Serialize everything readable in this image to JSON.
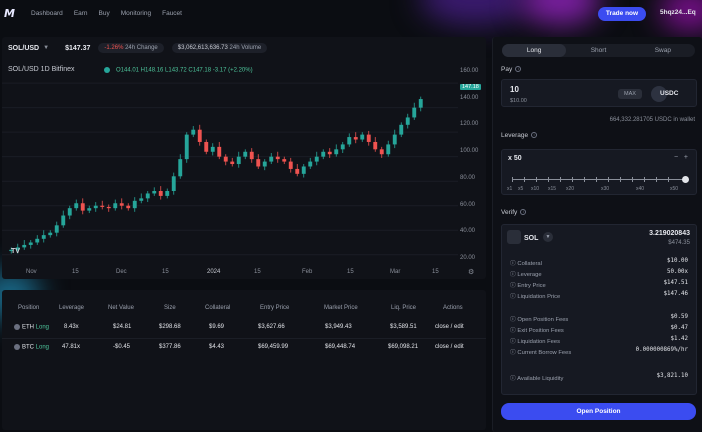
{
  "nav": {
    "logo": "M",
    "items": [
      "Dashboard",
      "Earn",
      "Buy",
      "Monitoring",
      "Faucet"
    ],
    "trade_label": "Trade now",
    "wallet": "5hqz24...Eq"
  },
  "ticker": {
    "pair": "SOL/USD",
    "price": "$147.37",
    "change": "-1.26%",
    "change_label": "24h Change",
    "volume": "$3,062,613,636.73",
    "volume_label": "24h Volume"
  },
  "chart": {
    "title": "SOL/USD  1D  Bitfinex",
    "ohlc": "O144.01  H148.16  L143.72  C147.18  -3.17 (+2.20%)",
    "last_tag": "147.18",
    "y_ticks": [
      "160.00",
      "140.00",
      "120.00",
      "100.00",
      "80.00",
      "60.00",
      "40.00",
      "20.00"
    ],
    "x_ticks": [
      "Nov",
      "15",
      "Dec",
      "15",
      "2024",
      "15",
      "Feb",
      "15",
      "Mar",
      "15"
    ]
  },
  "chart_data": {
    "type": "candlestick",
    "title": "SOL/USD 1D Bitfinex",
    "ylim": [
      10,
      165
    ],
    "x": [
      "Nov",
      "15",
      "Dec",
      "15",
      "2024",
      "15",
      "Feb",
      "15",
      "Mar",
      "15"
    ],
    "close": [
      24,
      26,
      28,
      30,
      33,
      36,
      38,
      44,
      52,
      58,
      62,
      56,
      58,
      60,
      59,
      58,
      62,
      60,
      58,
      64,
      66,
      70,
      72,
      68,
      72,
      84,
      98,
      118,
      122,
      112,
      104,
      108,
      100,
      96,
      94,
      100,
      104,
      98,
      92,
      96,
      100,
      98,
      96,
      90,
      86,
      92,
      96,
      100,
      104,
      102,
      106,
      110,
      116,
      114,
      118,
      112,
      106,
      102,
      110,
      118,
      126,
      132,
      140,
      147
    ]
  },
  "positions": {
    "headers": [
      "Position",
      "Leverage",
      "Net Value",
      "Size",
      "Collateral",
      "Entry Price",
      "Market Price",
      "Liq. Price",
      "Actions"
    ],
    "rows": [
      {
        "asset": "ETH",
        "side": "Long",
        "leverage": "8.43x",
        "net_value": "$24.81",
        "size": "$298.68",
        "collateral": "$9.69",
        "entry": "$3,627.66",
        "market": "$3,949.43",
        "liq": "$3,589.51",
        "actions": "close / edit"
      },
      {
        "asset": "BTC",
        "side": "Long",
        "leverage": "47.81x",
        "net_value": "-$0.45",
        "size": "$377.86",
        "collateral": "$4.43",
        "entry": "$69,459.99",
        "market": "$69,448.74",
        "liq": "$69,098.21",
        "actions": "close / edit"
      }
    ]
  },
  "side": {
    "tabs": [
      "Long",
      "Short",
      "Swap"
    ],
    "pay_label": "Pay",
    "pay_value": "10",
    "pay_usd": "$10.00",
    "max_label": "MAX",
    "pay_token": "USDC",
    "wallet_balance": "664,332.281705 USDC in wallet",
    "leverage_label": "Leverage",
    "leverage_value": "x 50",
    "leverage_marks": [
      "x1",
      "x5",
      "x10",
      "x15",
      "x20",
      "x30",
      "x40",
      "x50"
    ],
    "verify_label": "Verify",
    "verify_token": "SOL",
    "verify_amount": "3.219020843",
    "verify_usd": "$474.35",
    "details": [
      {
        "k": "Collateral",
        "v": "$10.00"
      },
      {
        "k": "Leverage",
        "v": "50.00x"
      },
      {
        "k": "Entry Price",
        "v": "$147.51"
      },
      {
        "k": "Liquidation Price",
        "v": "$147.46"
      }
    ],
    "fees": [
      {
        "k": "Open Position Fees",
        "v": "$0.59"
      },
      {
        "k": "Exit Position Fees",
        "v": "$0.47"
      },
      {
        "k": "Liquidation Fees",
        "v": "$1.42"
      },
      {
        "k": "Current Borrow Fees",
        "v": "0.000000869%/hr"
      }
    ],
    "available": {
      "k": "Available Liquidity",
      "v": "$3,821.10"
    },
    "open_label": "Open Position"
  },
  "colors": {
    "accent": "#3b4cf0",
    "up": "#26a69a",
    "down": "#ef5350"
  }
}
